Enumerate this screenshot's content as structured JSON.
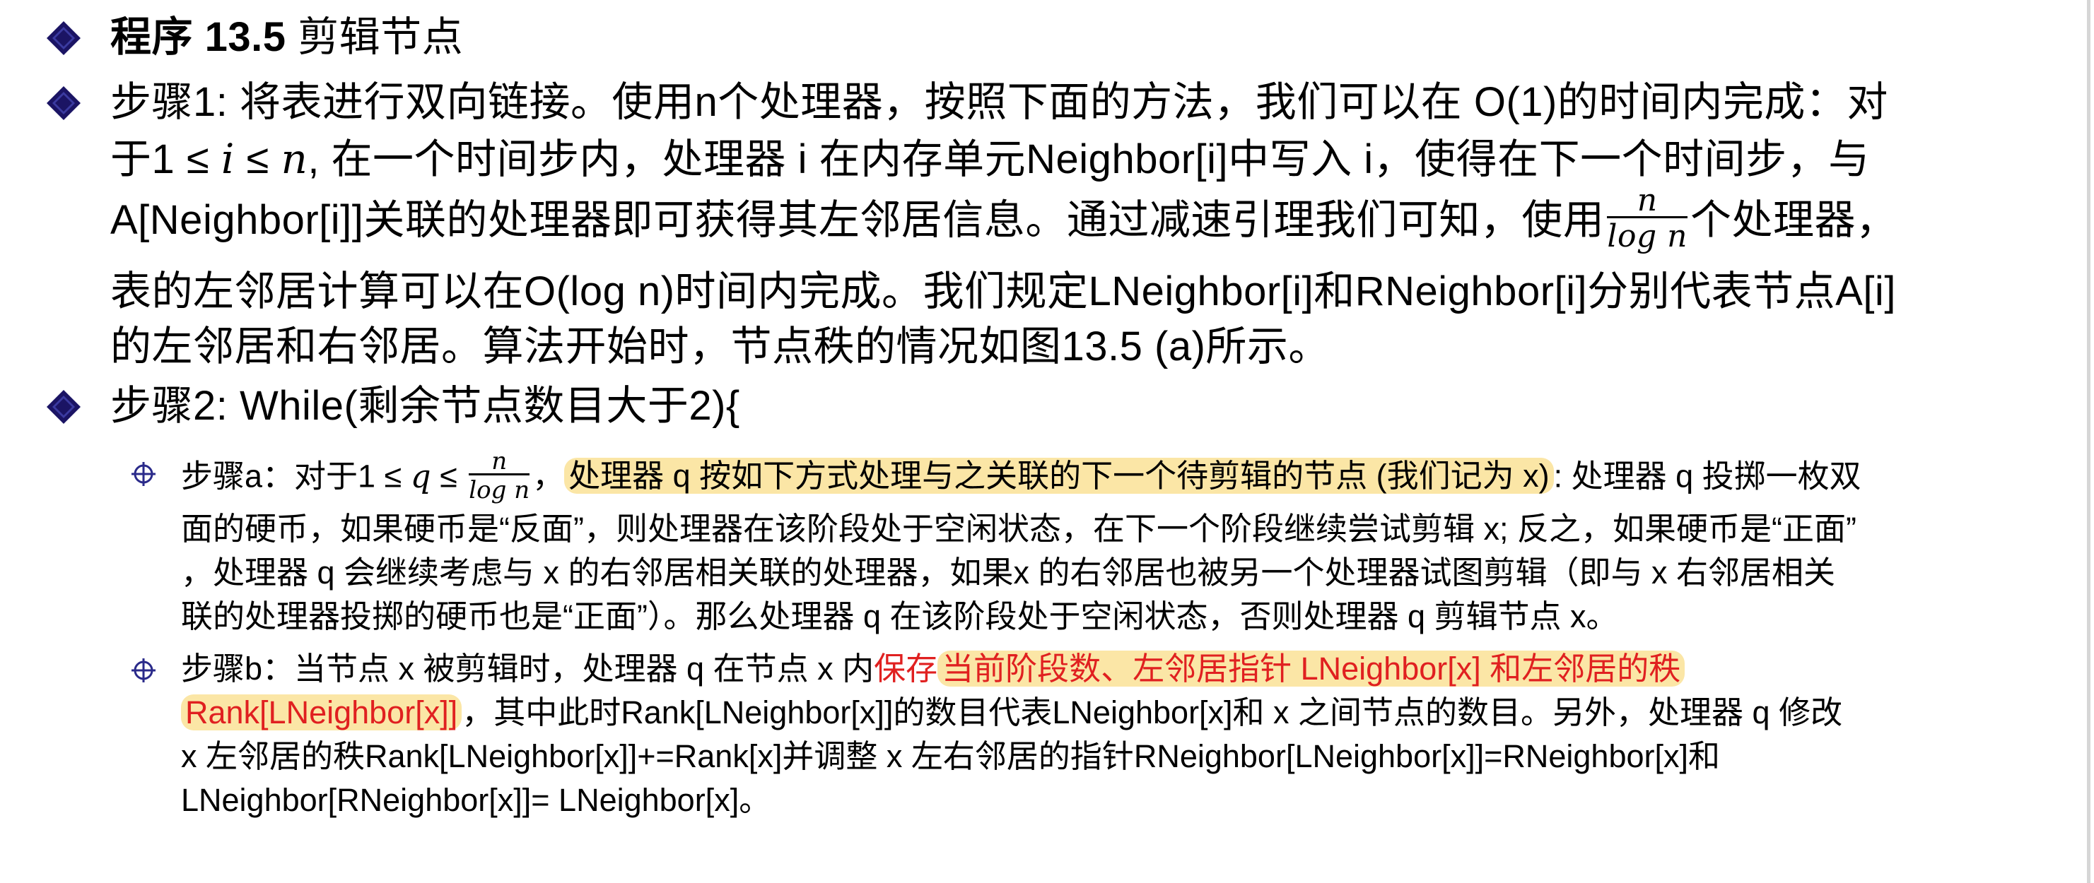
{
  "title": {
    "prefix": "程序 13.5",
    "rest": " 剪辑节点"
  },
  "step1": {
    "line1": "步骤1: 将表进行双向链接。使用n个处理器，按照下面的方法，我们可以在 O(1)的时间内完成：对",
    "line2_a": "于1 ≤ ",
    "line2_i": "i",
    "line2_b": " ≤ ",
    "line2_n": "n",
    "line2_c": ", 在一个时间步内，处理器 i 在内存单元Neighbor[i]中写入 i，使得在下一个时间步，与",
    "line3_a": "A[Neighbor[i]]关联的处理器即可获得其左邻居信息。通过减速引理我们可知，使用",
    "line3_frac_num": "n",
    "line3_frac_den": "log n",
    "line3_b": "个处理器，",
    "line4": "表的左邻居计算可以在O(log n)时间内完成。我们规定LNeighbor[i]和RNeighbor[i]分别代表节点A[i]",
    "line5": "的左邻居和右邻居。算法开始时，节点秩的情况如图13.5 (a)所示。"
  },
  "step2": {
    "line1": "步骤2:  While(剩余节点数目大于2){"
  },
  "step_a": {
    "line1_a": "步骤a：对于1 ≤ ",
    "line1_q": "q",
    "line1_b": " ≤ ",
    "frac_num": "n",
    "frac_den": "log n",
    "line1_c": "，",
    "line1_hl": "处理器 q 按如下方式处理与之关联的下一个待剪辑的节点 (我们记为 x)",
    "line1_d": ": 处理器 q 投掷一枚双",
    "line2": "面的硬币，如果硬币是“反面”，则处理器在该阶段处于空闲状态，在下一个阶段继续尝试剪辑 x; 反之，如果硬币是“正面”",
    "line3": "，处理器 q 会继续考虑与 x 的右邻居相关联的处理器，如果x 的右邻居也被另一个处理器试图剪辑（即与 x 右邻居相关",
    "line4": "联的处理器投掷的硬币也是“正面”）。那么处理器 q 在该阶段处于空闲状态，否则处理器 q 剪辑节点 x。"
  },
  "step_b": {
    "line1_a": "步骤b：当节点 x 被剪辑时，处理器 q 在节点 x 内",
    "line1_red": "保存",
    "line1_hl": "当前阶段数、左邻居指针 LNeighbor[x] 和左邻居的秩",
    "line2_hl": "Rank[LNeighbor[x]]",
    "line2_rest": "，其中此时Rank[LNeighbor[x]]的数目代表LNeighbor[x]和 x 之间节点的数目。另外，处理器 q 修改",
    "line3": "x 左邻居的秩Rank[LNeighbor[x]]+=Rank[x]并调整 x 左右邻居的指针RNeighbor[LNeighbor[x]]=RNeighbor[x]和",
    "line4": "LNeighbor[RNeighbor[x]]= LNeighbor[x]。"
  },
  "colors": {
    "bullet_fill": "#1b1464",
    "bullet_fill_l2": "#2a2a8a",
    "highlight": "#fbe6a6",
    "red_text": "#e02020"
  },
  "icons": [
    "diamond-bullet-icon",
    "circle-cross-bullet-icon"
  ]
}
